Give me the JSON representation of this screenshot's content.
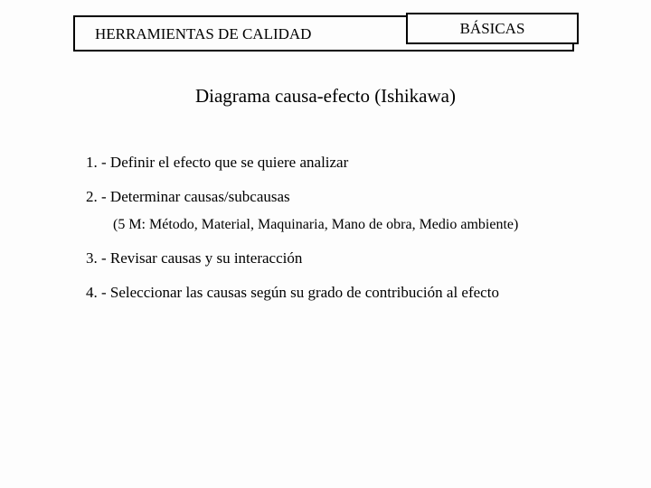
{
  "header": {
    "left_text": "HERRAMIENTAS DE CALIDAD",
    "right_box": "BÁSICAS"
  },
  "title": "Diagrama causa-efecto (Ishikawa)",
  "body": {
    "item1": "1. - Definir el efecto que se quiere analizar",
    "item2": "2. - Determinar causas/subcausas",
    "note": "(5 M: Método, Material, Maquinaria, Mano de obra, Medio ambiente)",
    "item3": "3. - Revisar causas y su interacción",
    "item4": "4. - Seleccionar las causas según su grado de contribución al efecto"
  }
}
